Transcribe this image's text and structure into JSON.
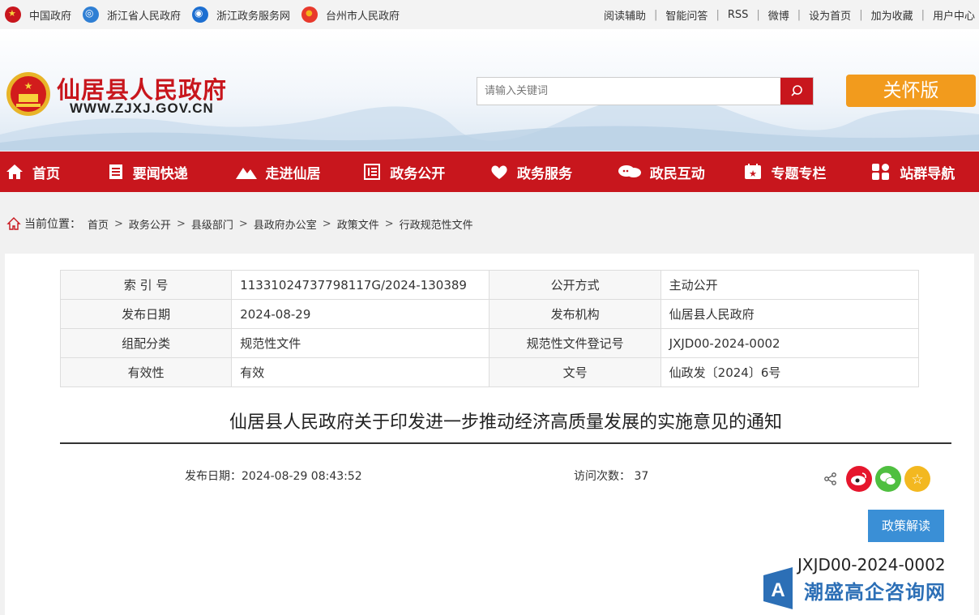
{
  "topbar": {
    "links": [
      "中国政府",
      "浙江省人民政府",
      "浙江政务服务网",
      "台州市人民政府"
    ],
    "right": [
      "阅读辅助",
      "智能问答",
      "RSS",
      "微博",
      "设为首页",
      "加为收藏",
      "用户中心"
    ]
  },
  "header": {
    "site_title": "仙居县人民政府",
    "site_url": "WWW.ZJXJ.GOV.CN",
    "search_placeholder": "请输入关键词",
    "care_label": "关怀版"
  },
  "nav": [
    "首页",
    "要闻快递",
    "走进仙居",
    "政务公开",
    "政务服务",
    "政民互动",
    "专题专栏",
    "站群导航"
  ],
  "breadcrumb": {
    "lead": "当前位置：",
    "items": [
      "首页",
      "政务公开",
      "县级部门",
      "县政府办公室",
      "政策文件",
      "行政规范性文件"
    ]
  },
  "meta": [
    {
      "k1": "索 引 号",
      "v1": "11331024737798117G/2024-130389",
      "k2": "公开方式",
      "v2": "主动公开"
    },
    {
      "k1": "发布日期",
      "v1": "2024-08-29",
      "k2": "发布机构",
      "v2": "仙居县人民政府"
    },
    {
      "k1": "组配分类",
      "v1": "规范性文件",
      "k2": "规范性文件登记号",
      "v2": "JXJD00-2024-0002"
    },
    {
      "k1": "有效性",
      "v1": "有效",
      "k2": "文号",
      "v2": "仙政发〔2024〕6号"
    }
  ],
  "doc": {
    "title": "仙居县人民政府关于印发进一步推动经济高质量发展的实施意见的通知",
    "pubdate_label": "发布日期：",
    "pubdate": "2024-08-29 08:43:52",
    "visits_label": "访问次数：",
    "visits": "37",
    "policy_button": "政策解读",
    "reg_code": "JXJD00-2024-0002"
  },
  "watermark": "潮盛高企咨询网",
  "colors": {
    "brand_red": "#c8161d",
    "care_orange": "#f29b1d",
    "policy_blue": "#3a8fd6"
  }
}
